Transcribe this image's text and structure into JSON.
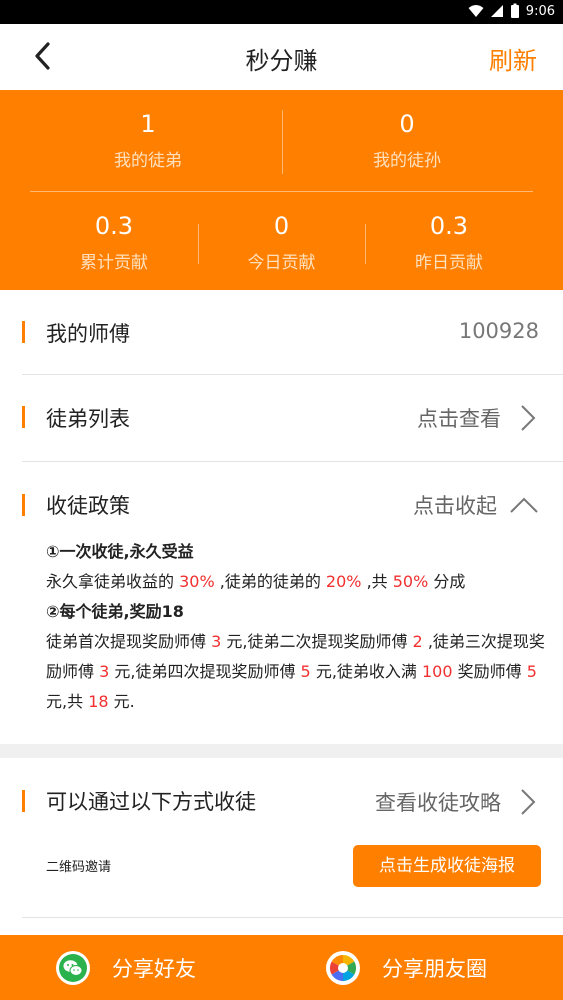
{
  "status_bar": {
    "time": "9:06"
  },
  "header": {
    "title": "秒分赚",
    "refresh_label": "刷新"
  },
  "stats": {
    "disciples": {
      "value": "1",
      "label": "我的徒弟"
    },
    "grand_disciples": {
      "value": "0",
      "label": "我的徒孙"
    },
    "total_contribution": {
      "value": "0.3",
      "label": "累计贡献"
    },
    "today_contribution": {
      "value": "0",
      "label": "今日贡献"
    },
    "yesterday_contribution": {
      "value": "0.3",
      "label": "昨日贡献"
    }
  },
  "master": {
    "label": "我的师傅",
    "value": "100928"
  },
  "disciple_list": {
    "label": "徒弟列表",
    "action": "点击查看"
  },
  "policy": {
    "label": "收徒政策",
    "action": "点击收起",
    "line1": "①一次收徒,永久受益",
    "line2": {
      "p1": "永久拿徒弟收益的 ",
      "r1": "30%",
      "p2": " ,徒弟的徒弟的 ",
      "r2": "20%",
      "p3": " ,共 ",
      "r3": "50%",
      "p4": " 分成"
    },
    "line3": "②每个徒弟,奖励18",
    "line4": {
      "p1": "徒弟首次提现奖励师傅 ",
      "r1": "3",
      "p2": " 元,徒弟二次提现奖励师傅 ",
      "r2": "2",
      "p3": " ,徒弟三次提现奖励师傅 ",
      "r3": "3",
      "p4": " 元,徒弟四次提现奖励师傅 ",
      "r4": "5",
      "p5": " 元,徒弟收入满 ",
      "r5": "100",
      "p6": " 奖励师傅 ",
      "r6": "5",
      "p7": " 元,共  ",
      "r7": "18",
      "p8": " 元."
    }
  },
  "recruit": {
    "label": "可以通过以下方式收徒",
    "action": "查看收徒攻略",
    "qr_label": "二维码邀请",
    "poster_button": "点击生成收徒海报"
  },
  "footer": {
    "share_friends": "分享好友",
    "share_moments": "分享朋友圈"
  },
  "colors": {
    "accent": "#ff7f00",
    "highlight_red": "#f23030"
  },
  "icons": [
    "wifi-icon",
    "signal-icon",
    "battery-icon",
    "back-arrow-icon",
    "chevron-right-icon",
    "chevron-up-icon",
    "wechat-icon",
    "moments-icon"
  ]
}
